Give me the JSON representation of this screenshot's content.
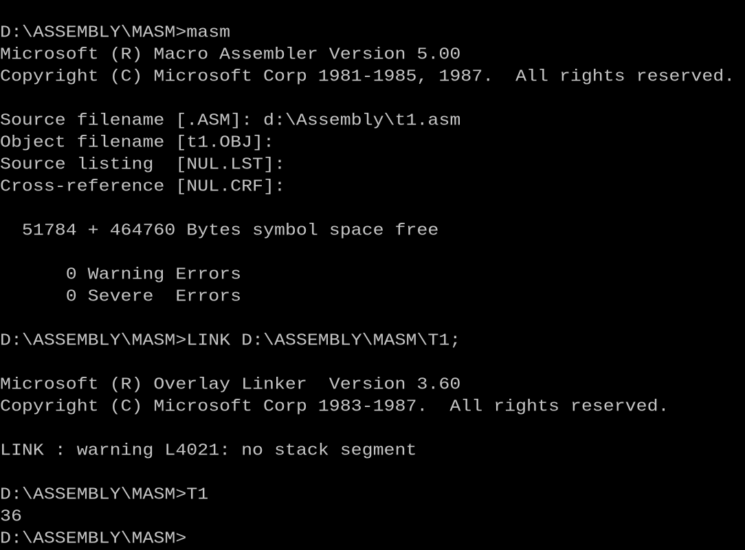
{
  "terminal": {
    "text_color": "#c4c4c4",
    "background": "#000000",
    "lines": [
      "",
      "D:\\ASSEMBLY\\MASM>masm",
      "Microsoft (R) Macro Assembler Version 5.00",
      "Copyright (C) Microsoft Corp 1981-1985, 1987.  All rights reserved.",
      "",
      "Source filename [.ASM]: d:\\Assembly\\t1.asm",
      "Object filename [t1.OBJ]:",
      "Source listing  [NUL.LST]:",
      "Cross-reference [NUL.CRF]:",
      "",
      "  51784 + 464760 Bytes symbol space free",
      "",
      "      0 Warning Errors",
      "      0 Severe  Errors",
      "",
      "D:\\ASSEMBLY\\MASM>LINK D:\\ASSEMBLY\\MASM\\T1;",
      "",
      "Microsoft (R) Overlay Linker  Version 3.60",
      "Copyright (C) Microsoft Corp 1983-1987.  All rights reserved.",
      "",
      "LINK : warning L4021: no stack segment",
      "",
      "D:\\ASSEMBLY\\MASM>T1",
      "36",
      "D:\\ASSEMBLY\\MASM>"
    ]
  }
}
